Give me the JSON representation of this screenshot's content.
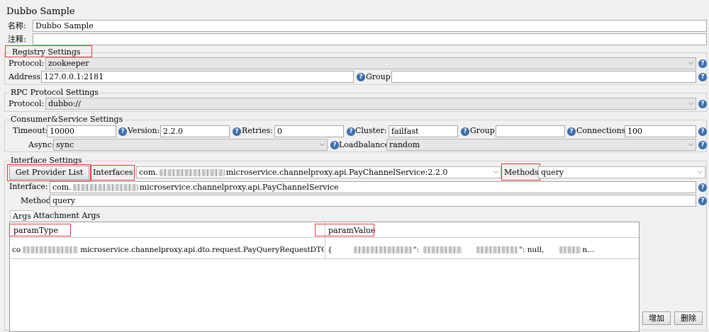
{
  "title": "Dubbo Sample",
  "name_label": "名称:",
  "name_value": "Dubbo Sample",
  "comment_label": "注释:",
  "comment_value": "",
  "registry": {
    "title": "Registry Settings",
    "protocol_label": "Protocol:",
    "protocol_value": "zookeeper",
    "address_label": "Address:",
    "address_value": "127.0.0.1:2181",
    "group_label": "Group:",
    "group_value": ""
  },
  "rpc": {
    "title": "RPC Protocol Settings",
    "protocol_label": "Protocol:",
    "protocol_value": "dubbo://"
  },
  "consumer": {
    "title": "Consumer&Service Settings",
    "timeout_label": "Timeout:",
    "timeout_value": "10000",
    "version_label": "Version:",
    "version_value": "2.2.0",
    "retries_label": "Retries:",
    "retries_value": "0",
    "cluster_label": "Cluster:",
    "cluster_value": "failfast",
    "group_label": "Group:",
    "group_value": "",
    "connections_label": "Connections:",
    "connections_value": "100",
    "async_label": "Async:",
    "async_value": "sync",
    "loadbalance_label": "Loadbalance:",
    "loadbalance_value": "random"
  },
  "iface": {
    "title": "Interface Settings",
    "get_provider_button": "Get Provider List",
    "interfaces_label": "Interfaces:",
    "interfaces_prefix": "com.",
    "interfaces_suffix": "microservice.channelproxy.api.PayChannelService:2.2.0",
    "methods_label": "Methods:",
    "methods_value": "query",
    "interface_label": "Interface:",
    "interface_prefix": "com.",
    "interface_suffix": "microservice.channelproxy.api.PayChannelService",
    "method_label": "Method:",
    "method_value": "query"
  },
  "tabs": [
    "Args",
    "Attachment Args"
  ],
  "table": {
    "col1": "paramType",
    "col2": "paramValue",
    "row_type_prefix": "co",
    "row_type_suffix": "microservice.channelproxy.api.dto.request.PayQueryRequestDTO",
    "row_value_1": "{",
    "row_value_2": "\":",
    "row_value_3": "\": null,",
    "row_value_4": "n..."
  },
  "buttons": {
    "add": "增加",
    "delete": "删除"
  },
  "icons": {
    "help": "help-icon",
    "chevron": "chevron-down-icon"
  },
  "colors": {
    "highlight_box": "#e33b3b",
    "help_icon": "#3d6fae"
  }
}
